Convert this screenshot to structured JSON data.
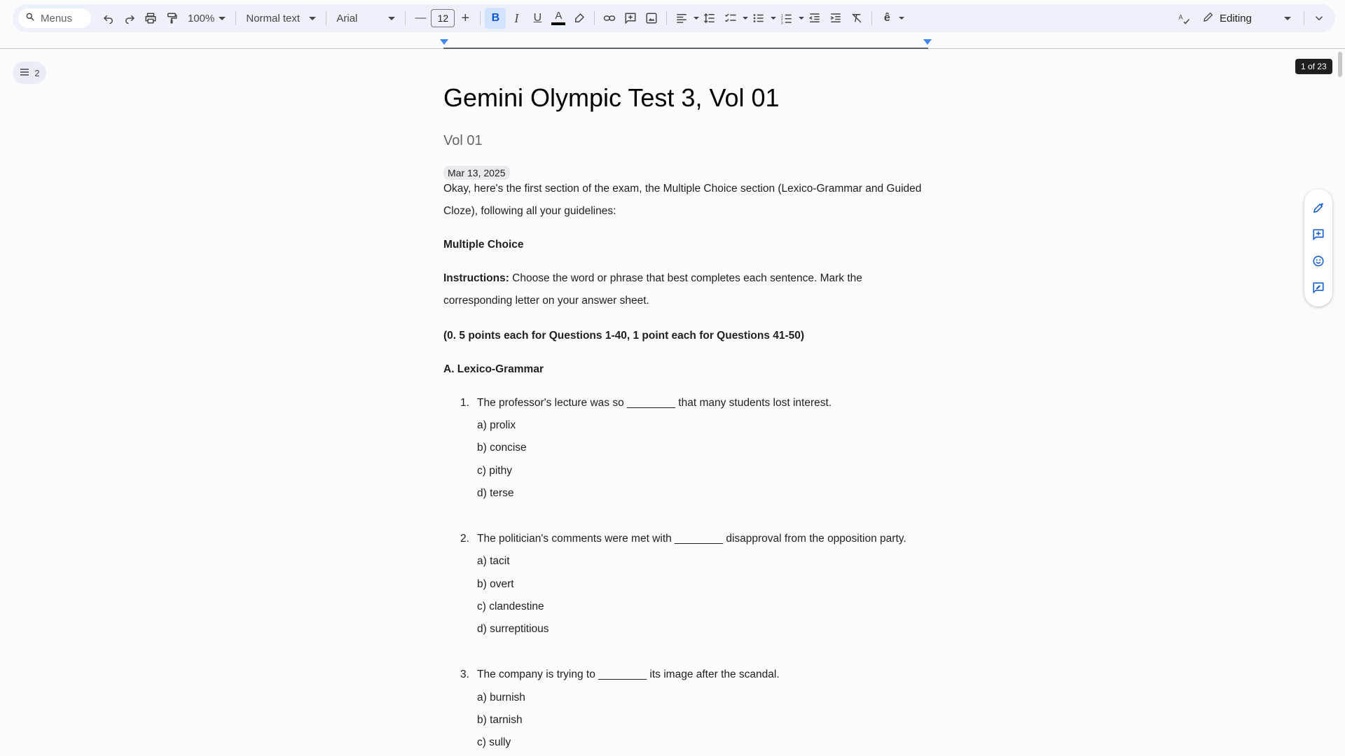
{
  "toolbar": {
    "search_placeholder": "Menus",
    "zoom": "100%",
    "style": "Normal text",
    "font": "Arial",
    "font_size": "12",
    "mode": "Editing"
  },
  "outline": {
    "count": "2"
  },
  "page_indicator": "1 of 23",
  "doc": {
    "title": "Gemini Olympic Test 3, Vol 01",
    "subtitle": "Vol 01",
    "date": "Mar 13, 2025",
    "intro": "Okay, here's the first section of the exam, the Multiple Choice section (Lexico-Grammar and Guided Cloze), following all your guidelines:",
    "section_heading": "Multiple Choice",
    "instructions_label": "Instructions:",
    "instructions_text": " Choose the word or phrase that best completes each sentence. Mark the corresponding letter on your answer sheet.",
    "points": "(0. 5 points each for Questions 1-40, 1 point each for Questions 41-50)",
    "part_heading": "A. Lexico-Grammar",
    "questions": [
      {
        "num": "1.",
        "text": "The professor's lecture was so ________ that many students lost interest.",
        "options": [
          "a) prolix",
          "b) concise",
          "c) pithy",
          "d) terse"
        ]
      },
      {
        "num": "2.",
        "text": "The politician's comments were met with ________ disapproval from the opposition party.",
        "options": [
          "a) tacit",
          "b) overt",
          "c) clandestine",
          "d) surreptitious"
        ]
      },
      {
        "num": "3.",
        "text": "The company is trying to ________ its image after the scandal.",
        "options": [
          "a) burnish",
          "b) tarnish",
          "c) sully"
        ]
      }
    ]
  }
}
